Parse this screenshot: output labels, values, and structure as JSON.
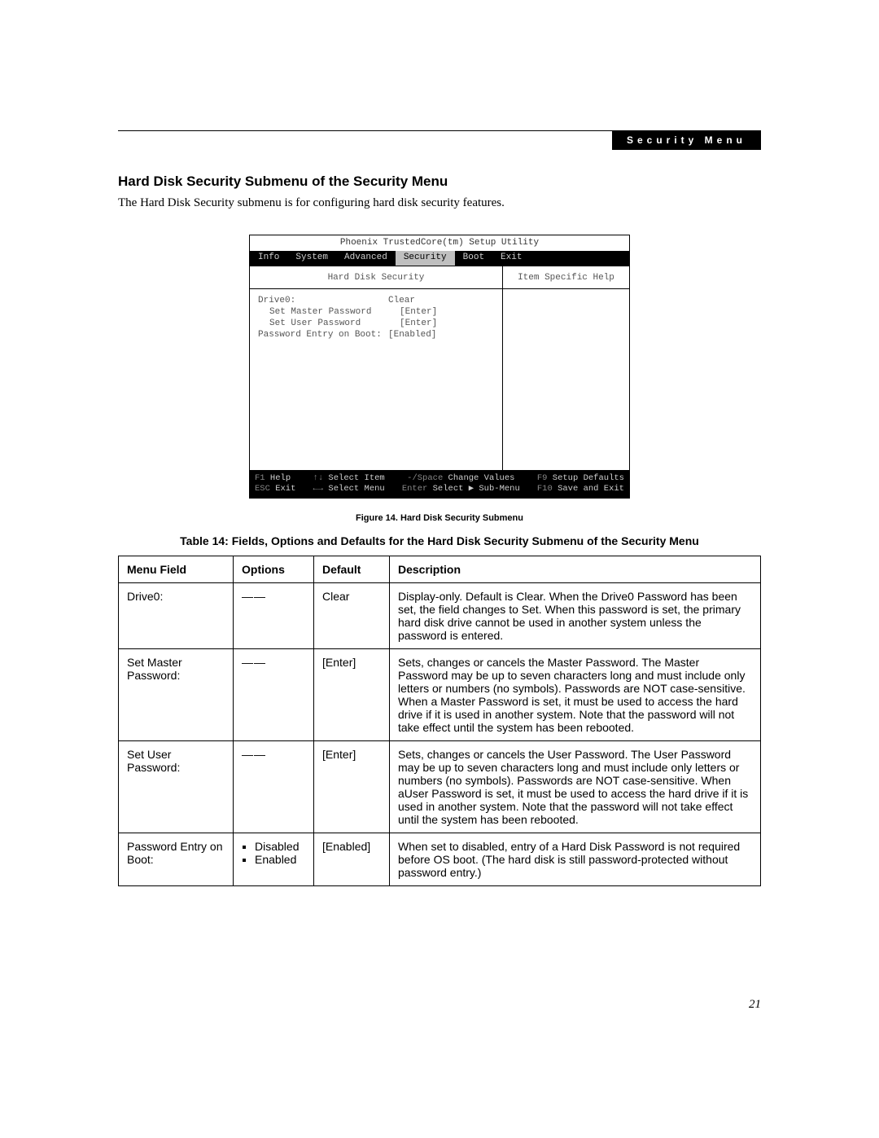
{
  "header": {
    "tag": "Security Menu"
  },
  "section": {
    "title": "Hard Disk Security Submenu of the Security Menu",
    "intro": "The Hard Disk Security submenu is for configuring hard disk security features."
  },
  "bios": {
    "title": "Phoenix TrustedCore(tm) Setup Utility",
    "tabs": [
      "Info",
      "System",
      "Advanced",
      "Security",
      "Boot",
      "Exit"
    ],
    "active_tab_index": 3,
    "panel_title": "Hard Disk Security",
    "help_title": "Item Specific Help",
    "items": [
      {
        "label": "Drive0:",
        "value": "Clear",
        "indent": 0
      },
      {
        "label": "Set Master Password",
        "value": "[Enter]",
        "indent": 1
      },
      {
        "label": "Set User Password",
        "value": "[Enter]",
        "indent": 1
      },
      {
        "label": "",
        "value": "",
        "indent": 0
      },
      {
        "label": "Password Entry on Boot:",
        "value": "[Enabled]",
        "indent": 0
      }
    ],
    "footer": {
      "r1": [
        {
          "key": "F1",
          "txt": "Help"
        },
        {
          "key": "↑↓",
          "txt": "Select Item"
        },
        {
          "key": "-/Space",
          "txt": "Change Values"
        },
        {
          "key": "F9",
          "txt": "Setup Defaults"
        }
      ],
      "r2": [
        {
          "key": "ESC",
          "txt": "Exit"
        },
        {
          "key": "←→",
          "txt": "Select Menu"
        },
        {
          "key": "Enter",
          "txt": "Select ▶ Sub-Menu"
        },
        {
          "key": "F10",
          "txt": "Save and Exit"
        }
      ]
    }
  },
  "figure_caption": "Figure 14.   Hard Disk Security Submenu",
  "table_title": "Table 14: Fields, Options and Defaults for the Hard Disk Security Submenu of the Security Menu",
  "table": {
    "headers": [
      "Menu Field",
      "Options",
      "Default",
      "Description"
    ],
    "rows": [
      {
        "menu": "Drive0:",
        "options_dash": true,
        "options": [],
        "def": "Clear",
        "desc": "Display-only. Default is Clear. When the Drive0 Password has been set, the field changes to Set. When this password is set, the primary hard disk drive cannot be used in another system unless the password is entered."
      },
      {
        "menu": "Set Master Password:",
        "options_dash": true,
        "options": [],
        "def": "[Enter]",
        "desc": "Sets, changes or cancels the Master Password. The Master Password may be up to seven characters long and must include only letters or numbers (no symbols). Passwords are NOT case-sensitive. When a Master Password is set, it must be used to access the hard drive if it is used in another system. Note that the password will not take effect until the system has been rebooted."
      },
      {
        "menu": "Set User Password:",
        "options_dash": true,
        "options": [],
        "def": "[Enter]",
        "desc": "Sets, changes or cancels the User Password. The User Password may be up to seven characters long and must include only letters or numbers (no symbols). Passwords are NOT case-sensitive. When aUser Password is set, it must be used to access the hard drive if it is used in another system. Note that the password will not take effect until the system has been rebooted."
      },
      {
        "menu": "Password Entry on Boot:",
        "options_dash": false,
        "options": [
          "Disabled",
          "Enabled"
        ],
        "def": "[Enabled]",
        "desc": "When set to disabled, entry of a Hard Disk Password is not required before OS boot. (The hard disk is still password-protected without password entry.)"
      }
    ]
  },
  "page_number": "21"
}
